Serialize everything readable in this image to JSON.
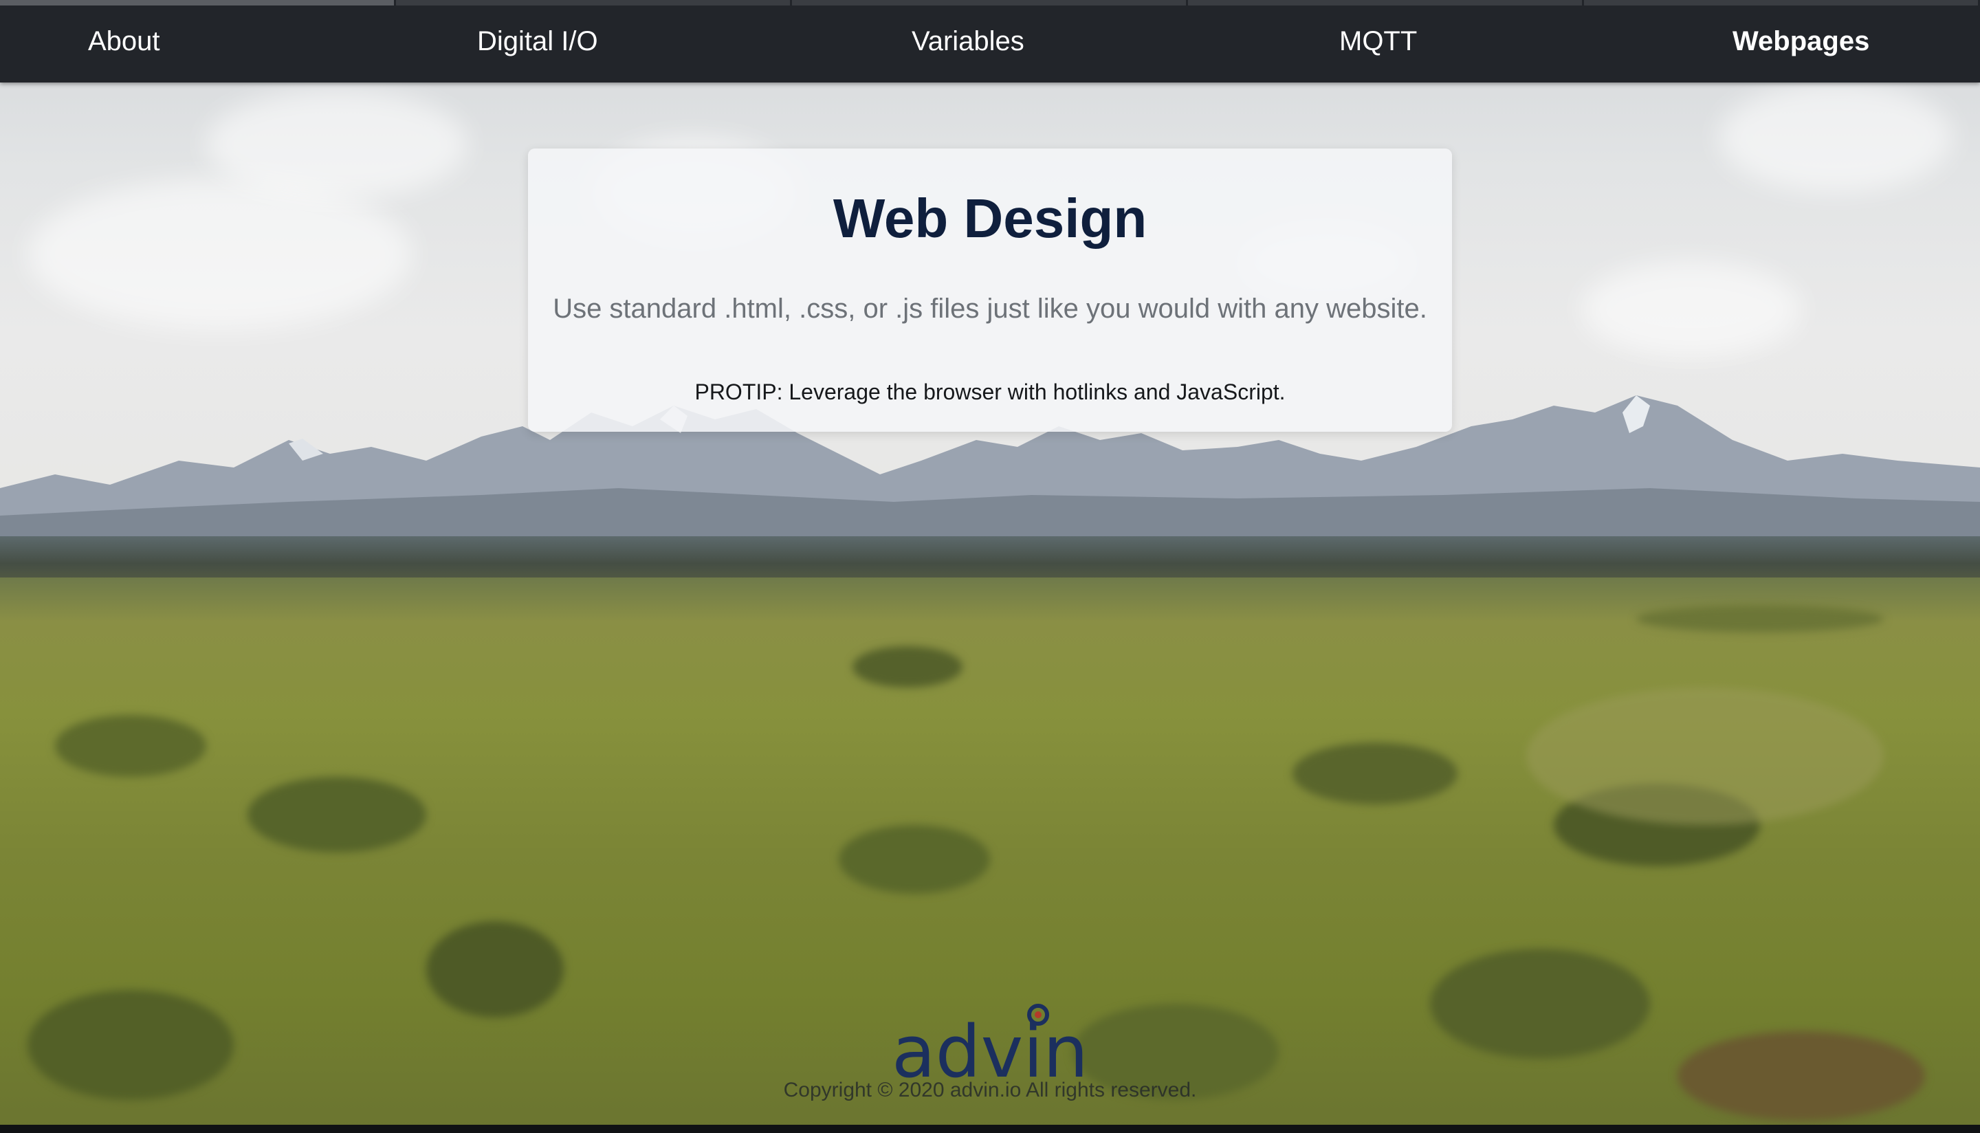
{
  "nav": {
    "items": [
      {
        "label": "About"
      },
      {
        "label": "Digital I/O"
      },
      {
        "label": "Variables"
      },
      {
        "label": "MQTT"
      },
      {
        "label": "Webpages"
      }
    ],
    "active_index": 4
  },
  "card": {
    "title": "Web Design",
    "subtitle": "Use standard .html, .css, or .js files just like you would with any website.",
    "tip": "PROTIP: Leverage the browser with hotlinks and JavaScript."
  },
  "footer": {
    "logo_text": "advin",
    "copyright": "Copyright © 2020 advin.io All rights reserved."
  },
  "colors": {
    "nav_bg": "#22252a",
    "title": "#0f1f3d",
    "logo": "#1b2f5e"
  },
  "icons": {
    "logo": "advin-logo"
  }
}
